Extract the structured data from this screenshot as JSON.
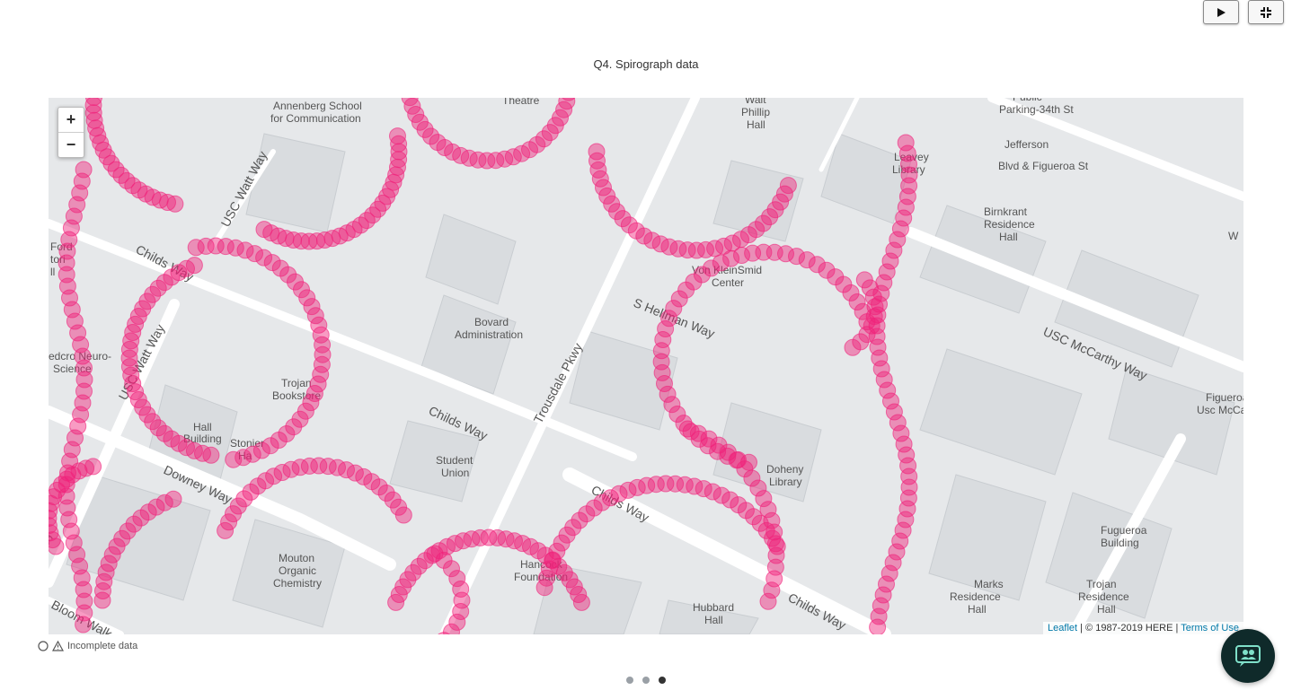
{
  "title": "Q4. Spirograph data",
  "toolbar": {
    "play_icon": "play-icon",
    "collapse_icon": "collapse-icon"
  },
  "map": {
    "zoom_in": "+",
    "zoom_out": "−",
    "attribution": {
      "leaflet": "Leaflet",
      "copyright": " | © 1987-2019 HERE | ",
      "terms": "Terms of Use"
    },
    "labels": [
      "Annenberg School",
      "for Communication",
      "Theatre",
      "Walt",
      "Phillip",
      "Hall",
      "Public",
      "Parking-34th St",
      "Jefferson",
      "Blvd & Figueroa St",
      "Leavey",
      "Library",
      "Birnkrant",
      "Residence",
      "Hall",
      "Ford",
      "tori",
      "ll",
      "USC Watt Way",
      "Childs Way",
      "Von KleinSmid",
      "Center",
      "Bovard",
      "Administration",
      "S Hellman Way",
      "USC McCarthy Way",
      "edcro Neuro-",
      "Science",
      "USC Watt Way",
      "Trojan",
      "Bookstore",
      "Trousdale Pkwy",
      "Figueroa",
      "Usc McCa",
      "Hall",
      "Building",
      "Stonier",
      "Ha",
      "Childs Way",
      "Student",
      "Union",
      "Doheny",
      "Library",
      "Downey Way",
      "Childs Way",
      "Mouton",
      "Organic",
      "Chemistry",
      "Hancock",
      "Foundation",
      "Fugueroa",
      "Building",
      "Marks",
      "Residence",
      "Hall",
      "Trojan",
      "Residence",
      "Hall",
      "Hubbard",
      "Hall",
      "Childs Way",
      "Bloom Walk",
      "W",
      "ay"
    ],
    "marker_color": "#f0217a"
  },
  "status": {
    "text": "Incomplete data"
  },
  "pager": {
    "count": 3,
    "active": 3
  },
  "chat_icon": "chat-people-icon"
}
